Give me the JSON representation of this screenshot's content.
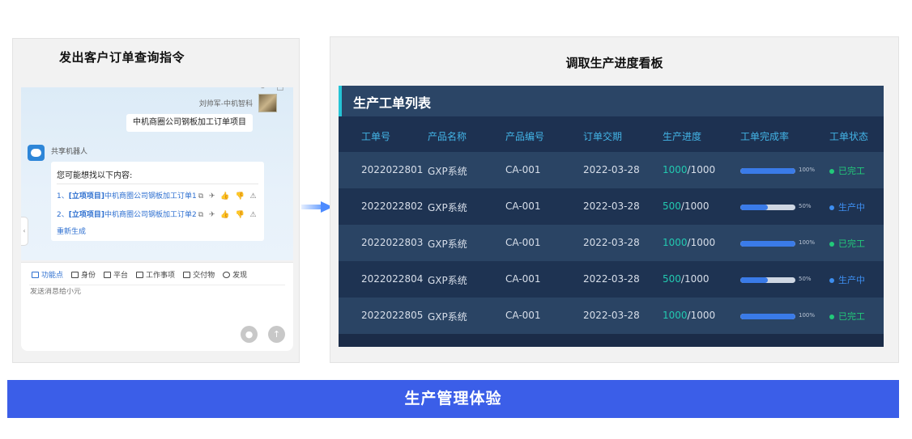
{
  "left_panel": {
    "title": "发出客户订单查询指令",
    "chat": {
      "user_name": "刘帅军-中机智科",
      "user_message": "中机商圈公司钢板加工订单项目",
      "bot_name": "共享机器人",
      "bot_intro": "您可能想找以下内容:",
      "results": [
        {
          "index": "1、",
          "tag": "[立项项目]",
          "text": "中机商圈公司钢板加工订单1"
        },
        {
          "index": "2、",
          "tag": "[立项项目]",
          "text": "中机商圈公司钢板加工订单2"
        }
      ],
      "regenerate": "重新生成"
    },
    "function_bar": [
      {
        "label": "功能点",
        "icon": "grid-icon",
        "active": true
      },
      {
        "label": "身份",
        "icon": "id-card-icon",
        "active": false
      },
      {
        "label": "平台",
        "icon": "platform-icon",
        "active": false
      },
      {
        "label": "工作事项",
        "icon": "task-icon",
        "active": false
      },
      {
        "label": "交付物",
        "icon": "layers-icon",
        "active": false
      },
      {
        "label": "发现",
        "icon": "refresh-icon",
        "active": false
      }
    ],
    "input_placeholder": "发送消息给小元"
  },
  "right_panel": {
    "title": "调取生产进度看板",
    "board_title": "生产工单列表",
    "columns": [
      "工单号",
      "产品名称",
      "产品编号",
      "订单交期",
      "生产进度",
      "工单完成率",
      "工单状态"
    ],
    "rows": [
      {
        "order_no": "2022022801",
        "product_name": "GXP系统",
        "product_code": "CA-001",
        "due_date": "2022-03-28",
        "progress_done": "1000",
        "progress_total": "/1000",
        "completion_rate": 1.0,
        "completion_label": "100%",
        "status": "已完工"
      },
      {
        "order_no": "2022022802",
        "product_name": "GXP系统",
        "product_code": "CA-001",
        "due_date": "2022-03-28",
        "progress_done": "500",
        "progress_total": "/1000",
        "completion_rate": 0.5,
        "completion_label": "50%",
        "status": "生产中"
      },
      {
        "order_no": "2022022803",
        "product_name": "GXP系统",
        "product_code": "CA-001",
        "due_date": "2022-03-28",
        "progress_done": "1000",
        "progress_total": "/1000",
        "completion_rate": 1.0,
        "completion_label": "100%",
        "status": "已完工"
      },
      {
        "order_no": "2022022804",
        "product_name": "GXP系统",
        "product_code": "CA-001",
        "due_date": "2022-03-28",
        "progress_done": "500",
        "progress_total": "/1000",
        "completion_rate": 0.5,
        "completion_label": "50%",
        "status": "生产中"
      },
      {
        "order_no": "2022022805",
        "product_name": "GXP系统",
        "product_code": "CA-001",
        "due_date": "2022-03-28",
        "progress_done": "1000",
        "progress_total": "/1000",
        "completion_rate": 1.0,
        "completion_label": "100%",
        "status": "已完工"
      }
    ],
    "status_colors": {
      "已完工": "#22c97a",
      "生产中": "#3d8ef0"
    }
  },
  "banner": {
    "text": "生产管理体验"
  },
  "colors": {
    "banner": "#3b5ee8",
    "board_bg": "#1b2c48",
    "accent_cyan": "#25c4d6",
    "header_text": "#43b4e6",
    "progress_num": "#22c9b0"
  }
}
